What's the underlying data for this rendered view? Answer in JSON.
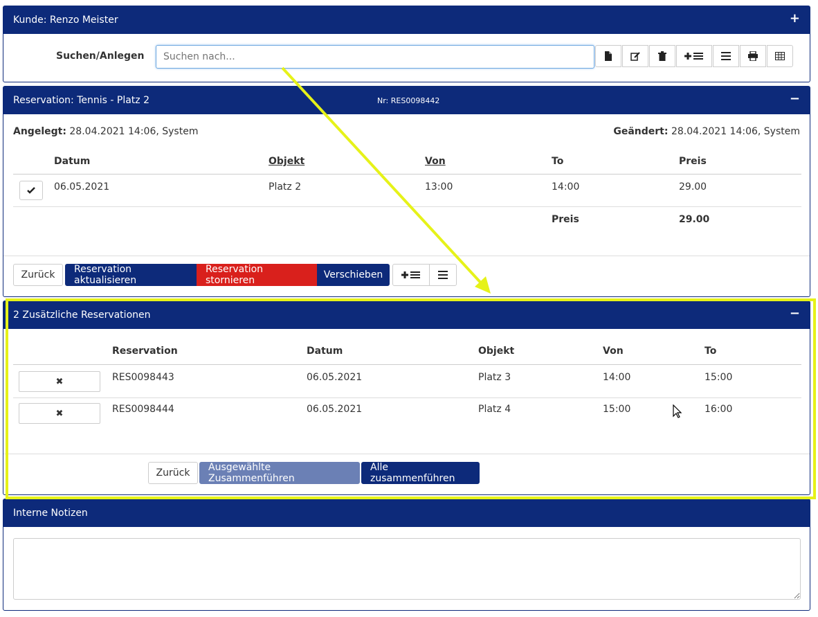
{
  "customer_panel": {
    "title": "Kunde: Renzo Meister",
    "toggle": "+",
    "search_label": "Suchen/Anlegen",
    "search_placeholder": "Suchen nach...",
    "toolbar_icons": [
      "new-document-icon",
      "edit-icon",
      "trash-icon",
      "add-list-icon",
      "list-icon",
      "print-icon",
      "table-icon"
    ]
  },
  "reservation_panel": {
    "title": "Reservation: Tennis - Platz 2",
    "number": "Nr: RES0098442",
    "toggle": "−",
    "created_label": "Angelegt:",
    "created_value": "28.04.2021 14:06, System",
    "changed_label": "Geändert:",
    "changed_value": "28.04.2021 14:06, System",
    "columns": [
      "Datum",
      "Objekt",
      "Von",
      "To",
      "Preis"
    ],
    "row": {
      "datum": "06.05.2021",
      "objekt": "Platz 2",
      "von": "13:00",
      "to": "14:00",
      "preis": "29.00"
    },
    "total_label": "Preis",
    "total_value": "29.00",
    "buttons": {
      "back": "Zurück",
      "update": "Reservation aktualisieren",
      "cancel": "Reservation stornieren",
      "move": "Verschieben"
    }
  },
  "additional_panel": {
    "title": "2 Zusätzliche Reservationen",
    "toggle": "−",
    "columns": [
      "Reservation",
      "Datum",
      "Objekt",
      "Von",
      "To"
    ],
    "rows": [
      {
        "reservation": "RES0098443",
        "datum": "06.05.2021",
        "objekt": "Platz 3",
        "von": "14:00",
        "to": "15:00"
      },
      {
        "reservation": "RES0098444",
        "datum": "06.05.2021",
        "objekt": "Platz 4",
        "von": "15:00",
        "to": "16:00"
      }
    ],
    "buttons": {
      "back": "Zurück",
      "merge_selected": "Ausgewählte Zusammenführen",
      "merge_all": "Alle zusammenführen"
    }
  },
  "notes_panel": {
    "title": "Interne Notizen"
  },
  "colors": {
    "header": "#0d2a7a",
    "danger": "#d9201c",
    "highlight": "#e6f219"
  }
}
